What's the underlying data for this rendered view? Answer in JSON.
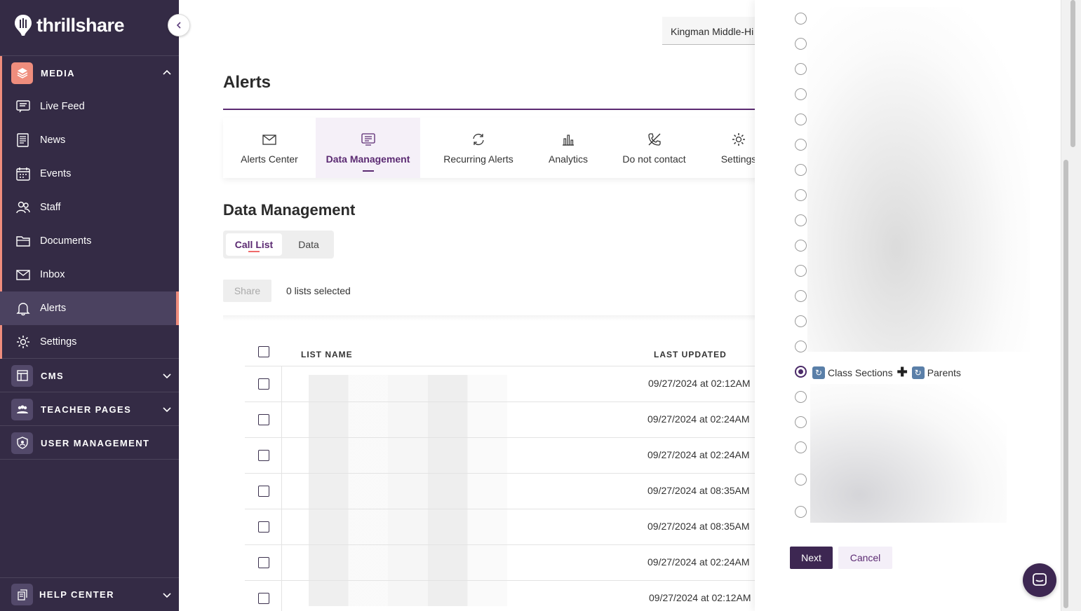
{
  "brand": {
    "name": "thrillshare"
  },
  "sidebar": {
    "media_label": "MEDIA",
    "items": [
      {
        "label": "Live Feed"
      },
      {
        "label": "News"
      },
      {
        "label": "Events"
      },
      {
        "label": "Staff"
      },
      {
        "label": "Documents"
      },
      {
        "label": "Inbox"
      },
      {
        "label": "Alerts"
      },
      {
        "label": "Settings"
      }
    ],
    "cms_label": "CMS",
    "teacher_pages_label": "TEACHER PAGES",
    "user_management_label": "USER MANAGEMENT",
    "help_center_label": "HELP CENTER"
  },
  "header": {
    "school_select": "Kingman Middle-Hi"
  },
  "main": {
    "page_title": "Alerts",
    "tabs": [
      {
        "label": "Alerts Center"
      },
      {
        "label": "Data Management"
      },
      {
        "label": "Recurring Alerts"
      },
      {
        "label": "Analytics"
      },
      {
        "label": "Do not contact"
      },
      {
        "label": "Settings"
      }
    ],
    "section_title": "Data Management",
    "segments": [
      {
        "label": "Call List"
      },
      {
        "label": "Data"
      }
    ],
    "share_label": "Share",
    "selected_count": "0 lists selected",
    "table": {
      "col_list_name": "LIST NAME",
      "col_last_updated": "LAST UPDATED",
      "rows": [
        {
          "last_updated": "09/27/2024 at 02:12AM"
        },
        {
          "last_updated": "09/27/2024 at 02:24AM"
        },
        {
          "last_updated": "09/27/2024 at 02:24AM"
        },
        {
          "last_updated": "09/27/2024 at 08:35AM"
        },
        {
          "last_updated": "09/27/2024 at 08:35AM"
        },
        {
          "last_updated": "09/27/2024 at 02:24AM"
        },
        {
          "last_updated": "09/27/2024 at 02:12AM"
        }
      ]
    }
  },
  "panel": {
    "selected_option": {
      "part1": "Class Sections",
      "plus": "✚",
      "part2": "Parents",
      "badge": "↻"
    },
    "next_label": "Next",
    "cancel_label": "Cancel"
  },
  "colors": {
    "sidebar_bg": "#342b45",
    "accent": "#5b2a72",
    "media_accent": "#ef8d7d",
    "primary_button": "#3d2752"
  }
}
